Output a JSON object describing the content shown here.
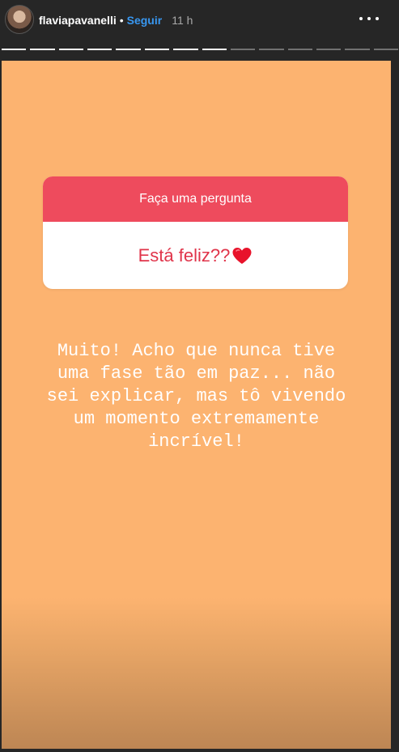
{
  "header": {
    "username": "flaviapavanelli",
    "separator": "•",
    "follow_label": "Seguir",
    "time": "11 h",
    "more_icon": "more-horizontal-icon",
    "avatar_icon": "profile-avatar"
  },
  "progress": {
    "total_segments": 14,
    "completed_segments": 8
  },
  "story": {
    "background_color": "#fcb370",
    "question_sticker": {
      "title": "Faça uma pergunta",
      "question": "Está feliz??",
      "emoji": "red-heart-icon",
      "header_color": "#ee4b5d",
      "question_color": "#e0344a"
    },
    "answer_lines": [
      "Muito! Acho que nunca tive",
      "uma fase tão em paz... não",
      "sei explicar, mas tô vivendo",
      "um momento extremamente",
      "incrível!"
    ]
  }
}
